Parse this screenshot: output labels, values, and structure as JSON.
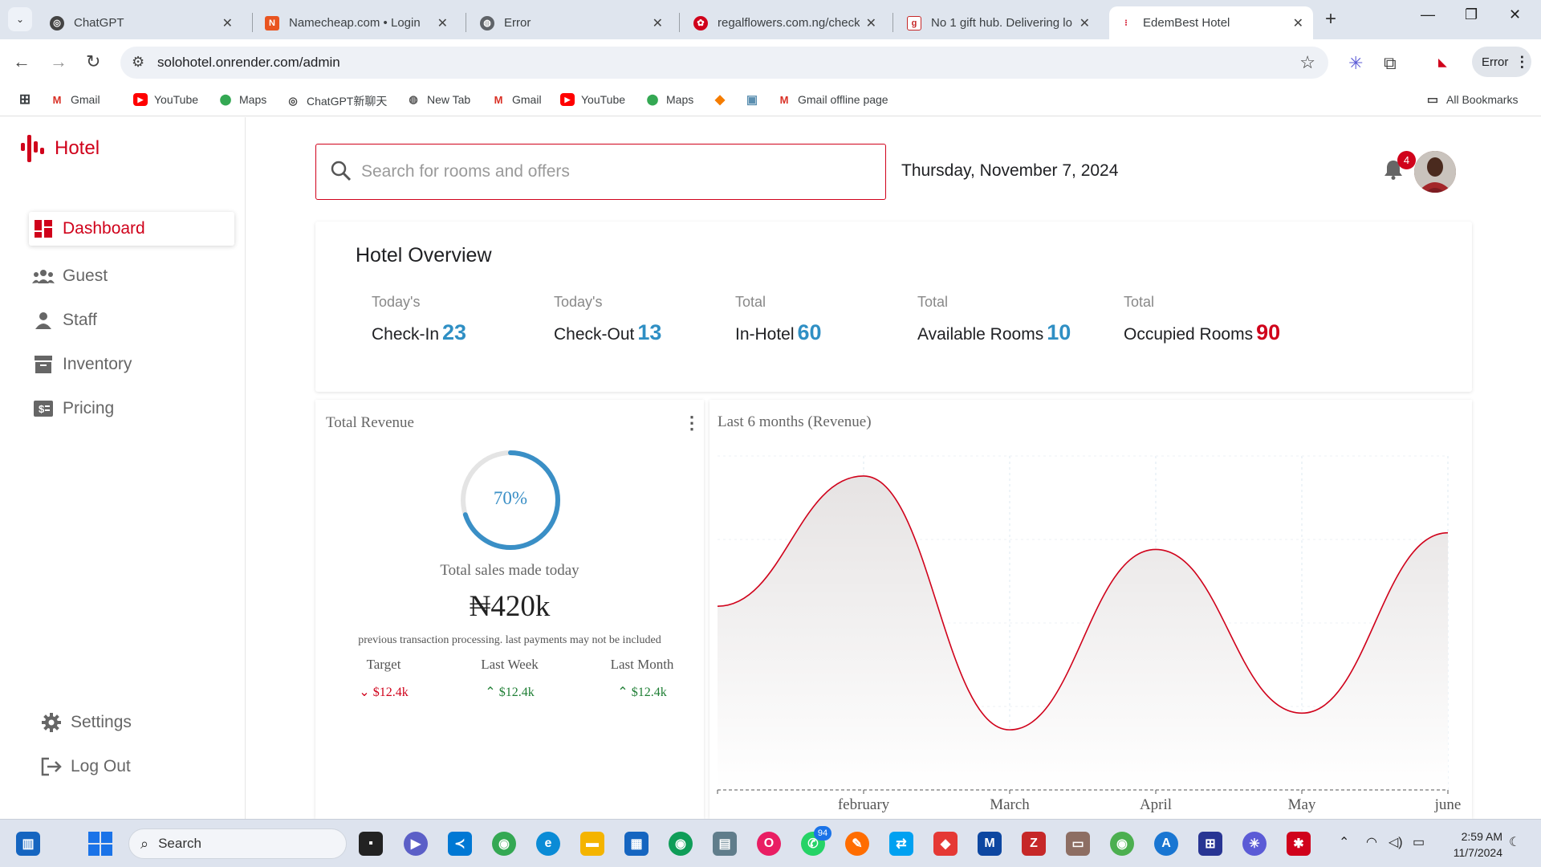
{
  "browser": {
    "tabs": [
      {
        "title": "ChatGPT",
        "icon": "chatgpt-icon",
        "color": "#444444"
      },
      {
        "title": "Namecheap.com • Login",
        "icon": "namecheap-icon",
        "color": "#e95420"
      },
      {
        "title": "Error",
        "icon": "globe-icon",
        "color": "#5f6368"
      },
      {
        "title": "regalflowers.com.ng/check",
        "icon": "regalflowers-icon",
        "color": "#d0021b"
      },
      {
        "title": "No 1 gift hub. Delivering lo",
        "icon": "gifthub-icon",
        "color": "#c62828"
      },
      {
        "title": "EdemBest Hotel",
        "icon": "hotel-icon",
        "color": "#d0021b"
      }
    ],
    "url": "solohotel.onrender.com/admin",
    "profile_label": "Error",
    "bookmarks": [
      {
        "label": "Gmail",
        "icon": "gmail-icon"
      },
      {
        "label": "YouTube",
        "icon": "youtube-icon"
      },
      {
        "label": "Maps",
        "icon": "maps-icon"
      },
      {
        "label": "ChatGPT新聊天",
        "icon": "chatgpt-icon"
      },
      {
        "label": "New Tab",
        "icon": "globe-icon"
      },
      {
        "label": "Gmail",
        "icon": "gmail-icon"
      },
      {
        "label": "YouTube",
        "icon": "youtube-icon"
      },
      {
        "label": "Maps",
        "icon": "maps-icon"
      },
      {
        "label": "",
        "icon": "box-icon"
      },
      {
        "label": "",
        "icon": "image-icon"
      },
      {
        "label": "Gmail offline page",
        "icon": "gmail-icon"
      }
    ],
    "all_bookmarks": "All Bookmarks"
  },
  "app": {
    "brand": "Hotel",
    "brand_color": "#d0021b",
    "nav": [
      {
        "label": "Dashboard",
        "icon": "dashboard-icon",
        "active": true
      },
      {
        "label": "Guest",
        "icon": "guests-icon",
        "active": false
      },
      {
        "label": "Staff",
        "icon": "person-icon",
        "active": false
      },
      {
        "label": "Inventory",
        "icon": "archive-icon",
        "active": false
      },
      {
        "label": "Pricing",
        "icon": "price-tag-icon",
        "active": false
      }
    ],
    "bottom_nav": [
      {
        "label": "Settings",
        "icon": "gear-icon"
      },
      {
        "label": "Log Out",
        "icon": "logout-icon"
      }
    ],
    "search_placeholder": "Search for rooms and offers",
    "date": "Thursday, November 7, 2024",
    "notifications": "4",
    "overview": {
      "title": "Hotel Overview",
      "stats": [
        {
          "caption": "Today's",
          "label": "Check-In",
          "value": "23",
          "color": "#2f8fc4"
        },
        {
          "caption": "Today's",
          "label": "Check-Out",
          "value": "13",
          "color": "#2f8fc4"
        },
        {
          "caption": "Total",
          "label": "In-Hotel",
          "value": "60",
          "color": "#2f8fc4"
        },
        {
          "caption": "Total",
          "label": "Available Rooms",
          "value": "10",
          "color": "#2f8fc4"
        },
        {
          "caption": "Total",
          "label": "Occupied Rooms",
          "value": "90",
          "color": "#d0021b"
        }
      ]
    },
    "revenue": {
      "title": "Total Revenue",
      "progress_percent": 70,
      "progress_label": "70%",
      "caption": "Total sales made today",
      "amount": "₦420k",
      "note": "previous transaction processing. last payments may not be included",
      "kpis": [
        {
          "label": "Target",
          "value": "$12.4k",
          "trend": "down",
          "color": "#d0021b"
        },
        {
          "label": "Last Week",
          "value": "$12.4k",
          "trend": "up",
          "color": "#1e7e34"
        },
        {
          "label": "Last Month",
          "value": "$12.4k",
          "trend": "up",
          "color": "#1e7e34"
        }
      ]
    }
  },
  "chart_data": {
    "type": "area",
    "title": "Last 6 months (Revenue)",
    "categories": [
      "",
      "february",
      "March",
      "April",
      "May",
      "june"
    ],
    "series": [
      {
        "values": [
          55,
          94,
          18,
          72,
          23,
          77
        ],
        "color": "#d0021b"
      }
    ],
    "ylim": [
      0,
      100
    ],
    "grid": true,
    "legend": "none"
  },
  "taskbar": {
    "search_label": "Search",
    "whatsapp_badge": "94",
    "time": "2:59 AM",
    "date": "11/7/2024"
  }
}
